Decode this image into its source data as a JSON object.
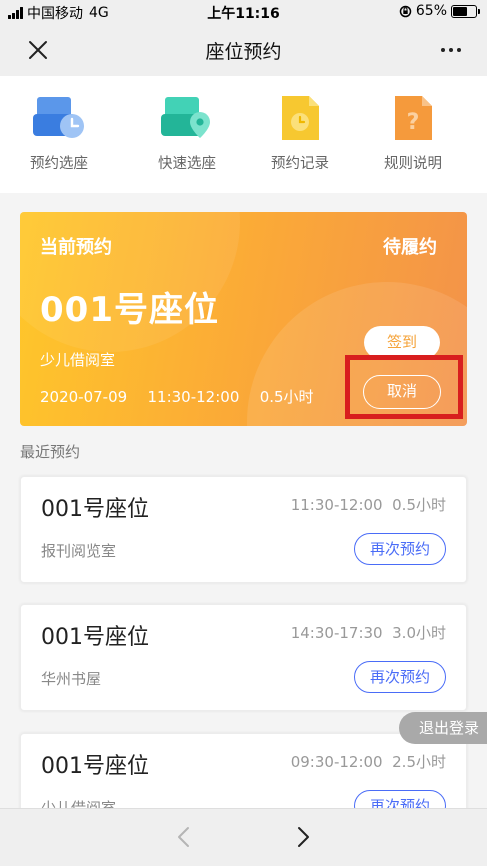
{
  "status_bar": {
    "carrier": "中国移动",
    "network": "4G",
    "time": "上午11:16",
    "battery": "65%",
    "battery_level": 0.65
  },
  "nav": {
    "title": "座位预约",
    "close_icon": "close-icon",
    "more_icon": "more-icon"
  },
  "quick_actions": [
    {
      "label": "预约选座",
      "icon": "reserve-seat-icon",
      "color": "#3a7de0"
    },
    {
      "label": "快速选座",
      "icon": "quick-seat-icon",
      "color": "#2ec4a6"
    },
    {
      "label": "预约记录",
      "icon": "record-icon",
      "color": "#f7c830"
    },
    {
      "label": "规则说明",
      "icon": "rules-icon",
      "color": "#f59a3c"
    }
  ],
  "current": {
    "heading": "当前预约",
    "status": "待履约",
    "seat": "001号座位",
    "room": "少儿借阅室",
    "date": "2020-07-09",
    "time_range": "11:30-12:00",
    "duration": "0.5小时",
    "checkin_label": "签到",
    "cancel_label": "取消"
  },
  "recent": {
    "title": "最近预约",
    "items": [
      {
        "seat": "001号座位",
        "time": "11:30-12:00",
        "duration": "0.5小时",
        "room": "报刊阅览室",
        "action": "再次预约"
      },
      {
        "seat": "001号座位",
        "time": "14:30-17:30",
        "duration": "3.0小时",
        "room": "华州书屋",
        "action": "再次预约"
      },
      {
        "seat": "001号座位",
        "time": "09:30-12:00",
        "duration": "2.5小时",
        "room": "少儿借阅室",
        "action": "再次预约"
      }
    ]
  },
  "logout_label": "退出登录",
  "bottom_nav": {
    "back_icon": "chevron-left-icon",
    "forward_icon": "chevron-right-icon"
  },
  "colors": {
    "accent": "#4a6cf7",
    "card_start": "#ffc72a",
    "card_end": "#f3924a",
    "highlight": "#d81e1e"
  }
}
